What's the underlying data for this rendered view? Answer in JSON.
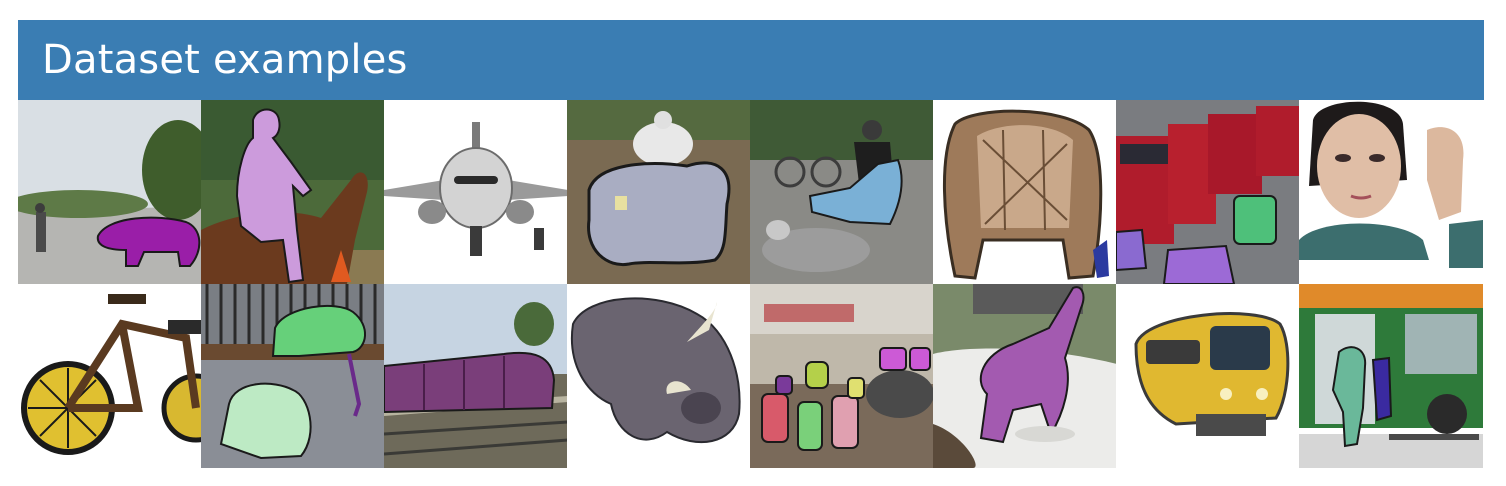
{
  "header": {
    "title": "Dataset examples"
  },
  "colors": {
    "banner": "#3a7db3",
    "title_text": "#ffffff"
  },
  "tiles": [
    {
      "label": "walking-man-dog-scene",
      "icon": "dog-mask"
    },
    {
      "label": "horse-rider-scene",
      "icon": "person-mask"
    },
    {
      "label": "airplane-scene",
      "icon": "airplane"
    },
    {
      "label": "motorcycle-scene",
      "icon": "motorcycle-mask"
    },
    {
      "label": "dog-cyclist-scene",
      "icon": "bicycle-mask"
    },
    {
      "label": "wicker-chair-scene",
      "icon": "chair"
    },
    {
      "label": "bus-street-scene",
      "icon": "bus-mask"
    },
    {
      "label": "woman-face-scene",
      "icon": "person"
    },
    {
      "label": "bicycle-scene",
      "icon": "bicycle"
    },
    {
      "label": "bench-dogs-scene",
      "icon": "dog-mask"
    },
    {
      "label": "train-tracks-scene",
      "icon": "train-mask"
    },
    {
      "label": "cow-scene",
      "icon": "cow"
    },
    {
      "label": "kitchen-bottles-scene",
      "icon": "bottle-mask"
    },
    {
      "label": "cat-scene",
      "icon": "cat-mask"
    },
    {
      "label": "yellow-train-scene",
      "icon": "train"
    },
    {
      "label": "green-bus-scene",
      "icon": "person-mask"
    }
  ]
}
